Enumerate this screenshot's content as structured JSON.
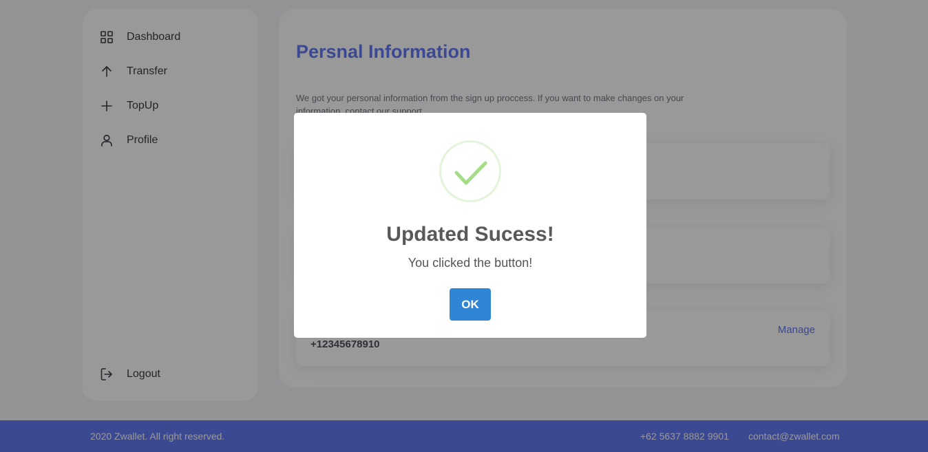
{
  "sidebar": {
    "items": [
      {
        "label": "Dashboard",
        "icon": "grid-icon"
      },
      {
        "label": "Transfer",
        "icon": "arrow-up-icon"
      },
      {
        "label": "TopUp",
        "icon": "plus-icon"
      },
      {
        "label": "Profile",
        "icon": "user-icon"
      }
    ],
    "logout": {
      "label": "Logout",
      "icon": "logout-icon"
    }
  },
  "main": {
    "title": "Persnal Information",
    "description": "We got your personal information from the sign up proccess. If you want to make changes on your information, contact our support.",
    "phone_card": {
      "value": "+12345678910",
      "manage_label": "Manage"
    }
  },
  "footer": {
    "copyright": "2020 Zwallet. All right reserved.",
    "phone": "+62 5637 8882 9901",
    "email": "contact@zwallet.com"
  },
  "modal": {
    "icon": "success-check-icon",
    "title": "Updated Sucess!",
    "text": "You clicked the button!",
    "ok_label": "OK"
  },
  "colors": {
    "primary": "#6379f4",
    "footer_bg": "#6379f4",
    "success": "#a5dc86",
    "ok_button": "#3085d6"
  }
}
